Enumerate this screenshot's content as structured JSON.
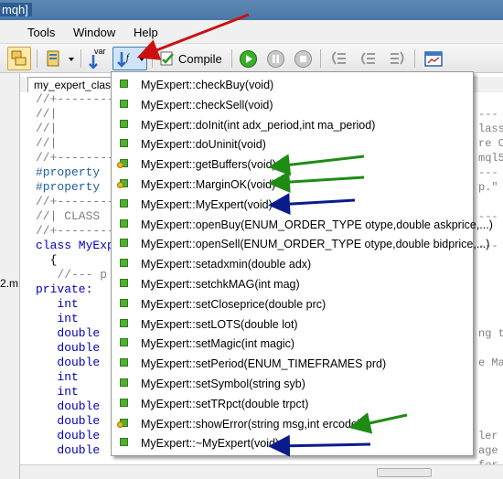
{
  "window": {
    "title_fragment": "mqh]"
  },
  "menu": [
    "Tools",
    "Window",
    "Help"
  ],
  "toolbar": {
    "var_label": "var",
    "compile_label": "Compile"
  },
  "editor": {
    "tab_label": "my_expert_class",
    "gutter_fragment": "2.m",
    "lines": [
      {
        "text": "//+---------",
        "color": "#7f7f7f"
      },
      {
        "text": "//|",
        "color": "#7f7f7f"
      },
      {
        "text": "//|",
        "color": "#7f7f7f"
      },
      {
        "text": "//|",
        "color": "#7f7f7f"
      },
      {
        "text": "//+---------",
        "color": "#7f7f7f"
      },
      {
        "text": "#property",
        "color": "#1f5fa0"
      },
      {
        "text": "#property",
        "color": "#1f5fa0"
      },
      {
        "text": "//+---------",
        "color": "#7f7f7f"
      },
      {
        "text": "//| CLASS",
        "color": "#7f7f7f"
      },
      {
        "text": "//+---------",
        "color": "#7f7f7f"
      },
      {
        "text": "class MyExp",
        "color": "#0000c0"
      },
      {
        "text": "  {",
        "color": "#000000"
      },
      {
        "text": "   //--- p",
        "color": "#7f7f7f"
      },
      {
        "text": "private:",
        "color": "#0000c0"
      },
      {
        "text": "   int",
        "color": "#0000c0"
      },
      {
        "text": "   int",
        "color": "#0000c0"
      },
      {
        "text": "   double",
        "color": "#0000c0"
      },
      {
        "text": "   double",
        "color": "#0000c0"
      },
      {
        "text": "   double",
        "color": "#0000c0"
      },
      {
        "text": "   int",
        "color": "#0000c0"
      },
      {
        "text": "   int",
        "color": "#0000c0"
      },
      {
        "text": "   double",
        "color": "#0000c0"
      },
      {
        "text": "   double",
        "color": "#0000c0"
      },
      {
        "text": "   double",
        "color": "#0000c0"
      },
      {
        "text": "   double",
        "color": "#0000c0"
      }
    ],
    "right_lines": [
      "---",
      "lass",
      "re C",
      "mql5",
      "---",
      "p.\"",
      "",
      "---",
      "",
      "---",
      "",
      "",
      "",
      "",
      "",
      "ng t",
      "",
      "e Ma",
      "",
      "",
      "",
      "",
      "ler",
      "age",
      "for"
    ]
  },
  "dropdown": {
    "items": [
      {
        "label": "MyExpert::checkBuy(void)",
        "icon": "method-public-icon"
      },
      {
        "label": "MyExpert::checkSell(void)",
        "icon": "method-public-icon"
      },
      {
        "label": "MyExpert::doInit(int adx_period,int ma_period)",
        "icon": "method-public-icon"
      },
      {
        "label": "MyExpert::doUninit(void)",
        "icon": "method-public-icon"
      },
      {
        "label": "MyExpert::getBuffers(void)",
        "icon": "method-private-icon"
      },
      {
        "label": "MyExpert::MarginOK(void)",
        "icon": "method-private-icon"
      },
      {
        "label": "MyExpert::MyExpert(void)",
        "icon": "method-public-icon"
      },
      {
        "label": "MyExpert::openBuy(ENUM_ORDER_TYPE otype,double askprice,...)",
        "icon": "method-public-icon"
      },
      {
        "label": "MyExpert::openSell(ENUM_ORDER_TYPE otype,double bidprice,...)",
        "icon": "method-public-icon"
      },
      {
        "label": "MyExpert::setadxmin(double adx)",
        "icon": "method-public-icon"
      },
      {
        "label": "MyExpert::setchkMAG(int mag)",
        "icon": "method-public-icon"
      },
      {
        "label": "MyExpert::setCloseprice(double prc)",
        "icon": "method-public-icon"
      },
      {
        "label": "MyExpert::setLOTS(double lot)",
        "icon": "method-public-icon"
      },
      {
        "label": "MyExpert::setMagic(int magic)",
        "icon": "method-public-icon"
      },
      {
        "label": "MyExpert::setPeriod(ENUM_TIMEFRAMES prd)",
        "icon": "method-public-icon"
      },
      {
        "label": "MyExpert::setSymbol(string syb)",
        "icon": "method-public-icon"
      },
      {
        "label": "MyExpert::setTRpct(double trpct)",
        "icon": "method-public-icon"
      },
      {
        "label": "MyExpert::showError(string msg,int ercode)",
        "icon": "method-private-icon"
      },
      {
        "label": "MyExpert::~MyExpert(void)",
        "icon": "method-public-icon"
      }
    ]
  },
  "colors": {
    "arrow_red": "#cc1010",
    "arrow_green": "#1e8c14",
    "arrow_blue": "#0a1c8c"
  }
}
